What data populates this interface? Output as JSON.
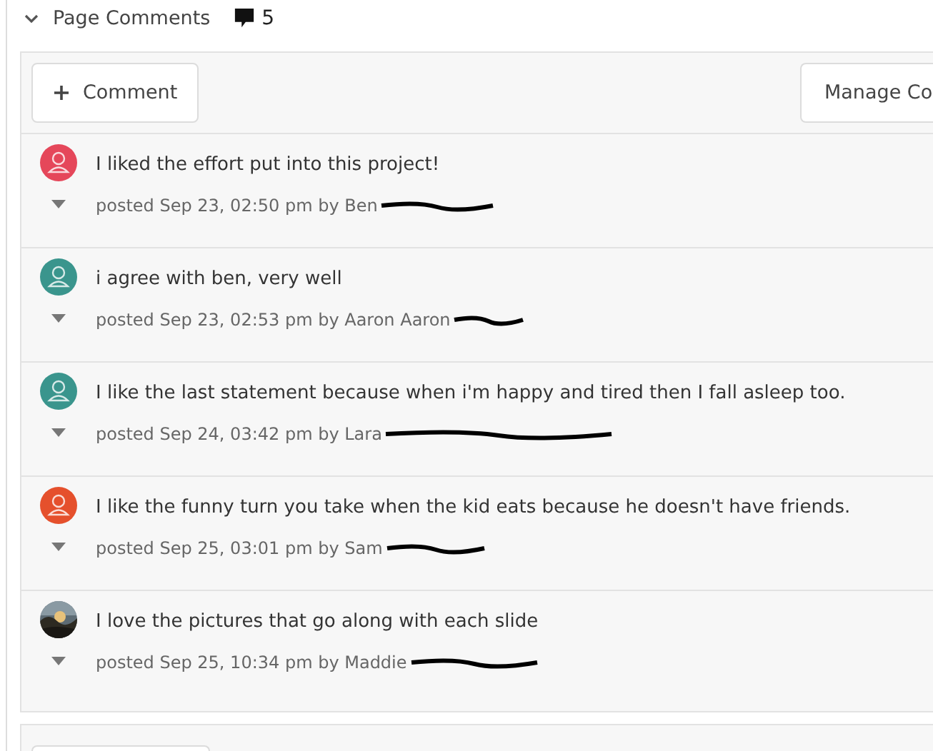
{
  "section": {
    "title": "Page Comments",
    "expanded": true,
    "count": "5"
  },
  "toolbar": {
    "add_button": "Comment",
    "manage_button": "Manage Co"
  },
  "comments": [
    {
      "avatar": {
        "kind": "icon",
        "color": "#e5475a"
      },
      "text": "I liked the effort put into this project!",
      "meta": "posted Sep 23, 02:50 pm by Ben"
    },
    {
      "avatar": {
        "kind": "icon",
        "color": "#3a958d"
      },
      "text": "i agree with ben, very well",
      "meta": "posted Sep 23, 02:53 pm by Aaron Aaron"
    },
    {
      "avatar": {
        "kind": "icon",
        "color": "#3a958d"
      },
      "text": "I like the last statement because when i'm happy and tired then I fall asleep too.",
      "meta": "posted Sep 24, 03:42 pm by Lara"
    },
    {
      "avatar": {
        "kind": "icon",
        "color": "#e5502c"
      },
      "text": "I like the funny turn you take when the kid eats because he doesn't have friends.",
      "meta": "posted Sep 25, 03:01 pm by Sam"
    },
    {
      "text": "I love the pictures that go along with each slide",
      "meta": "posted Sep 25, 10:34 pm by Maddie"
    }
  ]
}
